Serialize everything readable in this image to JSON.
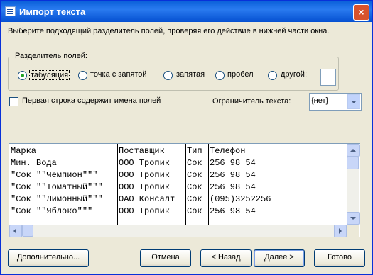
{
  "window": {
    "title": "Импорт текста",
    "close_label": "×"
  },
  "description": "Выберите подходящий разделитель полей, проверяя его действие в нижней части окна.",
  "delimiter": {
    "group_title": "Разделитель полей:",
    "options": [
      {
        "label": "табуляция",
        "checked": true
      },
      {
        "label": "точка с запятой",
        "checked": false
      },
      {
        "label": "запятая",
        "checked": false
      },
      {
        "label": "пробел",
        "checked": false
      },
      {
        "label": "другой:",
        "checked": false
      }
    ],
    "other_value": ""
  },
  "first_row_names": {
    "label": "Первая строка содержит имена полей",
    "checked": false
  },
  "text_qualifier": {
    "label": "Ограничитель текста:",
    "value": "{нет}"
  },
  "preview": {
    "rows": [
      [
        "Марка",
        "Поставщик",
        "Тип",
        "Телефон"
      ],
      [
        "Мин. Вода",
        "ООО Тропик",
        "Сок",
        "256 98 54"
      ],
      [
        "\"Сок \"\"Чемпион\"\"\"",
        "ООО Тропик",
        "Сок",
        "256 98 54"
      ],
      [
        "\"Сок \"\"Томатный\"\"\"",
        "ООО Тропик",
        "Сок",
        "256 98 54"
      ],
      [
        "\"Сок \"\"Лимонный\"\"\"",
        "ОАО Консалт",
        "Сок",
        "(095)3252256"
      ],
      [
        "\"Сок \"\"Яблоко\"\"\"",
        "ООО Тропик",
        "Сок",
        "256 98 54"
      ]
    ]
  },
  "buttons": {
    "advanced": "Дополнительно...",
    "cancel": "Отмена",
    "back": "< Назад",
    "next": "Далее >",
    "finish": "Готово"
  }
}
